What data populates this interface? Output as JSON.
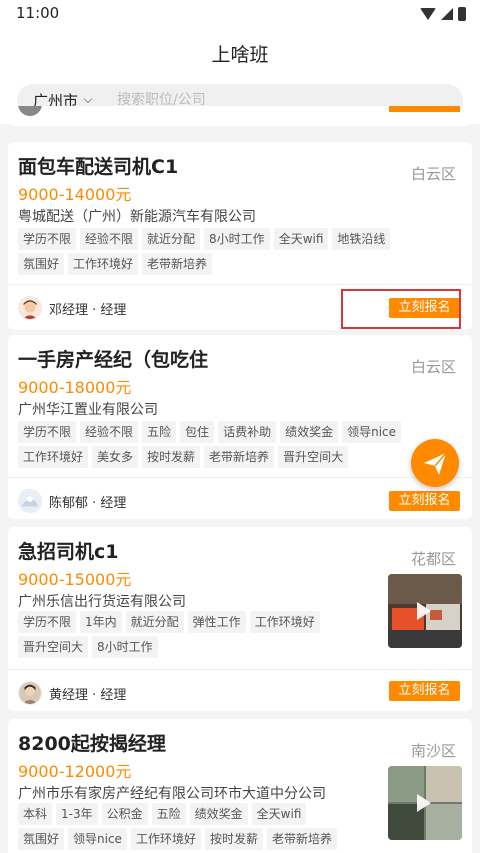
{
  "status_bar": {
    "time": "11:00"
  },
  "header": {
    "title": "上啥班"
  },
  "search": {
    "city": "广州市",
    "placeholder": "搜索职位/公司"
  },
  "jobs": [
    {
      "title": "面包车配送司机C1",
      "district": "白云区",
      "salary": "9000-14000元",
      "company": "粤城配送（广州）新能源汽车有限公司",
      "tags_row1": [
        "学历不限",
        "经验不限",
        "就近分配",
        "8小时工作",
        "全天wifi",
        "地铁沿线"
      ],
      "tags_row2": [
        "氛围好",
        "工作环境好",
        "老带新培养"
      ],
      "recruiter": "邓经理 · 经理",
      "apply": "立刻报名"
    },
    {
      "title": "一手房产经纪（包吃住",
      "district": "白云区",
      "salary": "9000-18000元",
      "company": "广州华江置业有限公司",
      "tags_row1": [
        "学历不限",
        "经验不限",
        "五险",
        "包住",
        "话费补助",
        "绩效奖金",
        "领导nice"
      ],
      "tags_row2": [
        "工作环境好",
        "美女多",
        "按时发薪",
        "老带新培养",
        "晋升空间大"
      ],
      "recruiter": "陈郁郁 · 经理",
      "apply": "立刻报名"
    },
    {
      "title": "急招司机c1",
      "district": "花都区",
      "salary": "9000-15000元",
      "company": "广州乐信出行货运有限公司",
      "tags_row1": [
        "学历不限",
        "1年内",
        "就近分配",
        "弹性工作",
        "工作环境好"
      ],
      "tags_row2": [
        "晋升空间大",
        "8小时工作"
      ],
      "recruiter": "黄经理 · 经理",
      "apply": "立刻报名"
    },
    {
      "title": "8200起按揭经理",
      "district": "南沙区",
      "salary": "9000-12000元",
      "company": "广州市乐有家房产经纪有限公司环市大道中分公司",
      "tags_row1": [
        "本科",
        "1-3年",
        "公积金",
        "五险",
        "绩效奖金",
        "全天wifi"
      ],
      "tags_row2": [
        "氛围好",
        "领导nice",
        "工作环境好",
        "按时发薪",
        "老带新培养"
      ]
    }
  ],
  "colors": {
    "accent": "#ff8a00",
    "highlight": "#d9363e"
  },
  "icons": {
    "fab": "paper-plane-icon",
    "city": "chevron-down-icon",
    "thumb": "play-icon"
  }
}
